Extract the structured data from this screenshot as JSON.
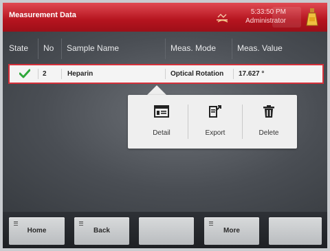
{
  "header": {
    "title": "Measurement Data",
    "time": "5:33:50 PM",
    "user": "Administrator"
  },
  "table": {
    "columns": [
      "State",
      "No",
      "Sample Name",
      "Meas. Mode",
      "Meas. Value"
    ],
    "rows": [
      {
        "state": "ok",
        "no": "2",
        "sample_name": "Heparin",
        "mode": "Optical Rotation",
        "value": "17.627 °"
      }
    ]
  },
  "popup": {
    "actions": [
      {
        "label": "Detail",
        "icon": "detail-icon"
      },
      {
        "label": "Export",
        "icon": "export-icon"
      },
      {
        "label": "Delete",
        "icon": "trash-icon"
      }
    ]
  },
  "footer": {
    "buttons": [
      {
        "label": "Home"
      },
      {
        "label": "Back"
      },
      {
        "label": ""
      },
      {
        "label": "More"
      },
      {
        "label": ""
      }
    ]
  },
  "colors": {
    "header_red": "#b5141f",
    "selection_border": "#d6303a",
    "check_green": "#2fa83a"
  }
}
